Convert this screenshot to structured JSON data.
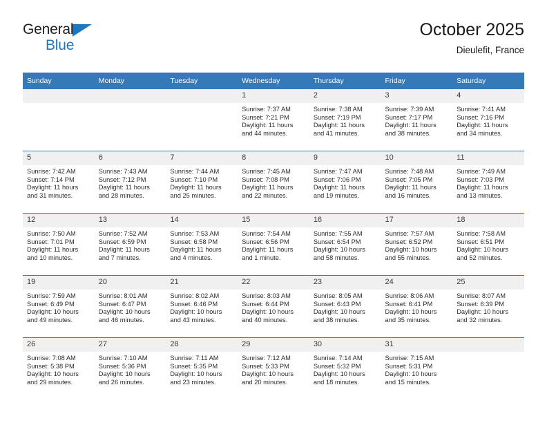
{
  "brand": {
    "line1": "General",
    "line2": "Blue",
    "accent_color": "#1d78c1",
    "text_color": "#231f20"
  },
  "header": {
    "title": "October 2025",
    "subtitle": "Dieulefit, France"
  },
  "theme": {
    "header_bg": "#3479b8",
    "header_text": "#ffffff",
    "daynum_bg": "#f0f0f0",
    "cell_bg": "#ffffff",
    "border": "#3479b8"
  },
  "weekdays": [
    "Sunday",
    "Monday",
    "Tuesday",
    "Wednesday",
    "Thursday",
    "Friday",
    "Saturday"
  ],
  "weeks": [
    [
      {
        "day": "",
        "sunrise": "",
        "sunset": "",
        "daylight1": "",
        "daylight2": "",
        "empty": true
      },
      {
        "day": "",
        "sunrise": "",
        "sunset": "",
        "daylight1": "",
        "daylight2": "",
        "empty": true
      },
      {
        "day": "",
        "sunrise": "",
        "sunset": "",
        "daylight1": "",
        "daylight2": "",
        "empty": true
      },
      {
        "day": "1",
        "sunrise": "Sunrise: 7:37 AM",
        "sunset": "Sunset: 7:21 PM",
        "daylight1": "Daylight: 11 hours",
        "daylight2": "and 44 minutes.",
        "empty": false
      },
      {
        "day": "2",
        "sunrise": "Sunrise: 7:38 AM",
        "sunset": "Sunset: 7:19 PM",
        "daylight1": "Daylight: 11 hours",
        "daylight2": "and 41 minutes.",
        "empty": false
      },
      {
        "day": "3",
        "sunrise": "Sunrise: 7:39 AM",
        "sunset": "Sunset: 7:17 PM",
        "daylight1": "Daylight: 11 hours",
        "daylight2": "and 38 minutes.",
        "empty": false
      },
      {
        "day": "4",
        "sunrise": "Sunrise: 7:41 AM",
        "sunset": "Sunset: 7:16 PM",
        "daylight1": "Daylight: 11 hours",
        "daylight2": "and 34 minutes.",
        "empty": false
      }
    ],
    [
      {
        "day": "5",
        "sunrise": "Sunrise: 7:42 AM",
        "sunset": "Sunset: 7:14 PM",
        "daylight1": "Daylight: 11 hours",
        "daylight2": "and 31 minutes.",
        "empty": false
      },
      {
        "day": "6",
        "sunrise": "Sunrise: 7:43 AM",
        "sunset": "Sunset: 7:12 PM",
        "daylight1": "Daylight: 11 hours",
        "daylight2": "and 28 minutes.",
        "empty": false
      },
      {
        "day": "7",
        "sunrise": "Sunrise: 7:44 AM",
        "sunset": "Sunset: 7:10 PM",
        "daylight1": "Daylight: 11 hours",
        "daylight2": "and 25 minutes.",
        "empty": false
      },
      {
        "day": "8",
        "sunrise": "Sunrise: 7:45 AM",
        "sunset": "Sunset: 7:08 PM",
        "daylight1": "Daylight: 11 hours",
        "daylight2": "and 22 minutes.",
        "empty": false
      },
      {
        "day": "9",
        "sunrise": "Sunrise: 7:47 AM",
        "sunset": "Sunset: 7:06 PM",
        "daylight1": "Daylight: 11 hours",
        "daylight2": "and 19 minutes.",
        "empty": false
      },
      {
        "day": "10",
        "sunrise": "Sunrise: 7:48 AM",
        "sunset": "Sunset: 7:05 PM",
        "daylight1": "Daylight: 11 hours",
        "daylight2": "and 16 minutes.",
        "empty": false
      },
      {
        "day": "11",
        "sunrise": "Sunrise: 7:49 AM",
        "sunset": "Sunset: 7:03 PM",
        "daylight1": "Daylight: 11 hours",
        "daylight2": "and 13 minutes.",
        "empty": false
      }
    ],
    [
      {
        "day": "12",
        "sunrise": "Sunrise: 7:50 AM",
        "sunset": "Sunset: 7:01 PM",
        "daylight1": "Daylight: 11 hours",
        "daylight2": "and 10 minutes.",
        "empty": false
      },
      {
        "day": "13",
        "sunrise": "Sunrise: 7:52 AM",
        "sunset": "Sunset: 6:59 PM",
        "daylight1": "Daylight: 11 hours",
        "daylight2": "and 7 minutes.",
        "empty": false
      },
      {
        "day": "14",
        "sunrise": "Sunrise: 7:53 AM",
        "sunset": "Sunset: 6:58 PM",
        "daylight1": "Daylight: 11 hours",
        "daylight2": "and 4 minutes.",
        "empty": false
      },
      {
        "day": "15",
        "sunrise": "Sunrise: 7:54 AM",
        "sunset": "Sunset: 6:56 PM",
        "daylight1": "Daylight: 11 hours",
        "daylight2": "and 1 minute.",
        "empty": false
      },
      {
        "day": "16",
        "sunrise": "Sunrise: 7:55 AM",
        "sunset": "Sunset: 6:54 PM",
        "daylight1": "Daylight: 10 hours",
        "daylight2": "and 58 minutes.",
        "empty": false
      },
      {
        "day": "17",
        "sunrise": "Sunrise: 7:57 AM",
        "sunset": "Sunset: 6:52 PM",
        "daylight1": "Daylight: 10 hours",
        "daylight2": "and 55 minutes.",
        "empty": false
      },
      {
        "day": "18",
        "sunrise": "Sunrise: 7:58 AM",
        "sunset": "Sunset: 6:51 PM",
        "daylight1": "Daylight: 10 hours",
        "daylight2": "and 52 minutes.",
        "empty": false
      }
    ],
    [
      {
        "day": "19",
        "sunrise": "Sunrise: 7:59 AM",
        "sunset": "Sunset: 6:49 PM",
        "daylight1": "Daylight: 10 hours",
        "daylight2": "and 49 minutes.",
        "empty": false
      },
      {
        "day": "20",
        "sunrise": "Sunrise: 8:01 AM",
        "sunset": "Sunset: 6:47 PM",
        "daylight1": "Daylight: 10 hours",
        "daylight2": "and 46 minutes.",
        "empty": false
      },
      {
        "day": "21",
        "sunrise": "Sunrise: 8:02 AM",
        "sunset": "Sunset: 6:46 PM",
        "daylight1": "Daylight: 10 hours",
        "daylight2": "and 43 minutes.",
        "empty": false
      },
      {
        "day": "22",
        "sunrise": "Sunrise: 8:03 AM",
        "sunset": "Sunset: 6:44 PM",
        "daylight1": "Daylight: 10 hours",
        "daylight2": "and 40 minutes.",
        "empty": false
      },
      {
        "day": "23",
        "sunrise": "Sunrise: 8:05 AM",
        "sunset": "Sunset: 6:43 PM",
        "daylight1": "Daylight: 10 hours",
        "daylight2": "and 38 minutes.",
        "empty": false
      },
      {
        "day": "24",
        "sunrise": "Sunrise: 8:06 AM",
        "sunset": "Sunset: 6:41 PM",
        "daylight1": "Daylight: 10 hours",
        "daylight2": "and 35 minutes.",
        "empty": false
      },
      {
        "day": "25",
        "sunrise": "Sunrise: 8:07 AM",
        "sunset": "Sunset: 6:39 PM",
        "daylight1": "Daylight: 10 hours",
        "daylight2": "and 32 minutes.",
        "empty": false
      }
    ],
    [
      {
        "day": "26",
        "sunrise": "Sunrise: 7:08 AM",
        "sunset": "Sunset: 5:38 PM",
        "daylight1": "Daylight: 10 hours",
        "daylight2": "and 29 minutes.",
        "empty": false
      },
      {
        "day": "27",
        "sunrise": "Sunrise: 7:10 AM",
        "sunset": "Sunset: 5:36 PM",
        "daylight1": "Daylight: 10 hours",
        "daylight2": "and 26 minutes.",
        "empty": false
      },
      {
        "day": "28",
        "sunrise": "Sunrise: 7:11 AM",
        "sunset": "Sunset: 5:35 PM",
        "daylight1": "Daylight: 10 hours",
        "daylight2": "and 23 minutes.",
        "empty": false
      },
      {
        "day": "29",
        "sunrise": "Sunrise: 7:12 AM",
        "sunset": "Sunset: 5:33 PM",
        "daylight1": "Daylight: 10 hours",
        "daylight2": "and 20 minutes.",
        "empty": false
      },
      {
        "day": "30",
        "sunrise": "Sunrise: 7:14 AM",
        "sunset": "Sunset: 5:32 PM",
        "daylight1": "Daylight: 10 hours",
        "daylight2": "and 18 minutes.",
        "empty": false
      },
      {
        "day": "31",
        "sunrise": "Sunrise: 7:15 AM",
        "sunset": "Sunset: 5:31 PM",
        "daylight1": "Daylight: 10 hours",
        "daylight2": "and 15 minutes.",
        "empty": false
      },
      {
        "day": "",
        "sunrise": "",
        "sunset": "",
        "daylight1": "",
        "daylight2": "",
        "empty": true
      }
    ]
  ]
}
